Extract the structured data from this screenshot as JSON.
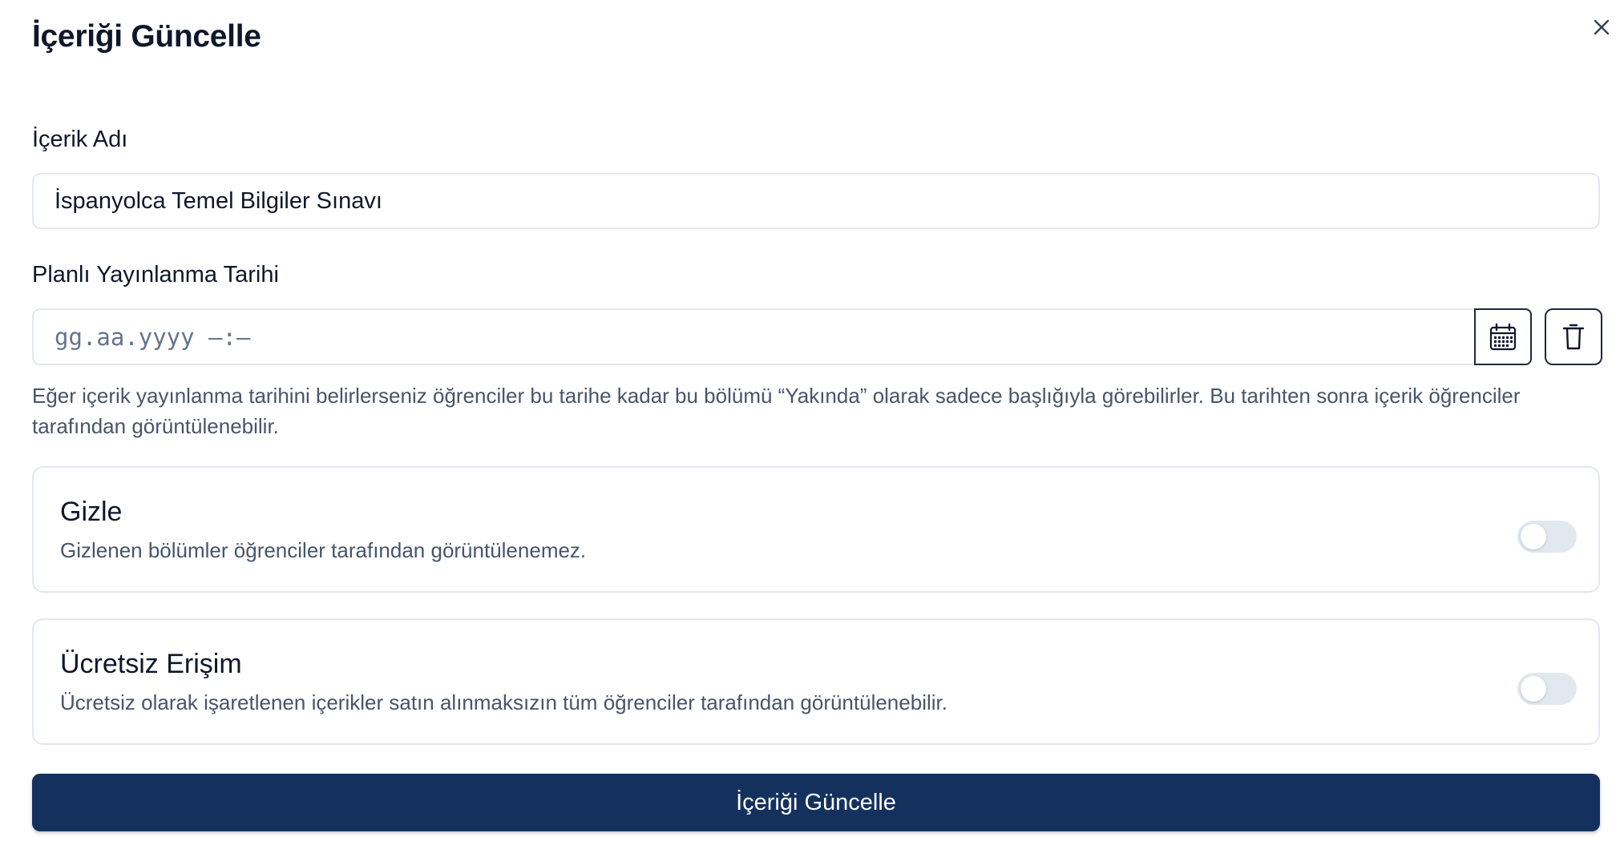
{
  "dialog": {
    "title": "İçeriği Güncelle",
    "close_icon": "close-icon"
  },
  "content_name": {
    "label": "İçerik Adı",
    "value": "İspanyolca Temel Bilgiler Sınavı"
  },
  "publish_date": {
    "label": "Planlı Yayınlanma Tarihi",
    "placeholder": "gg.aa.yyyy —:—",
    "calendar_icon": "calendar-icon",
    "delete_icon": "trash-icon",
    "help_text": "Eğer içerik yayınlanma tarihini belirlerseniz öğrenciler bu tarihe kadar bu bölümü “Yakında” olarak sadece başlığıyla görebilirler. Bu tarihten sonra içerik öğrenciler tarafından görüntülenebilir."
  },
  "hide_option": {
    "title": "Gizle",
    "description": "Gizlenen bölümler öğrenciler tarafından görüntülenemez.",
    "enabled": false
  },
  "free_access_option": {
    "title": "Ücretsiz Erişim",
    "description": "Ücretsiz olarak işaretlenen içerikler satın alınmaksızın tüm öğrenciler tarafından görüntülenebilir.",
    "enabled": false
  },
  "submit": {
    "label": "İçeriği Güncelle"
  },
  "colors": {
    "primary": "#14315e",
    "border": "#e2e8f0",
    "muted_text": "#475569",
    "toggle_off": "#e2e8f0"
  }
}
